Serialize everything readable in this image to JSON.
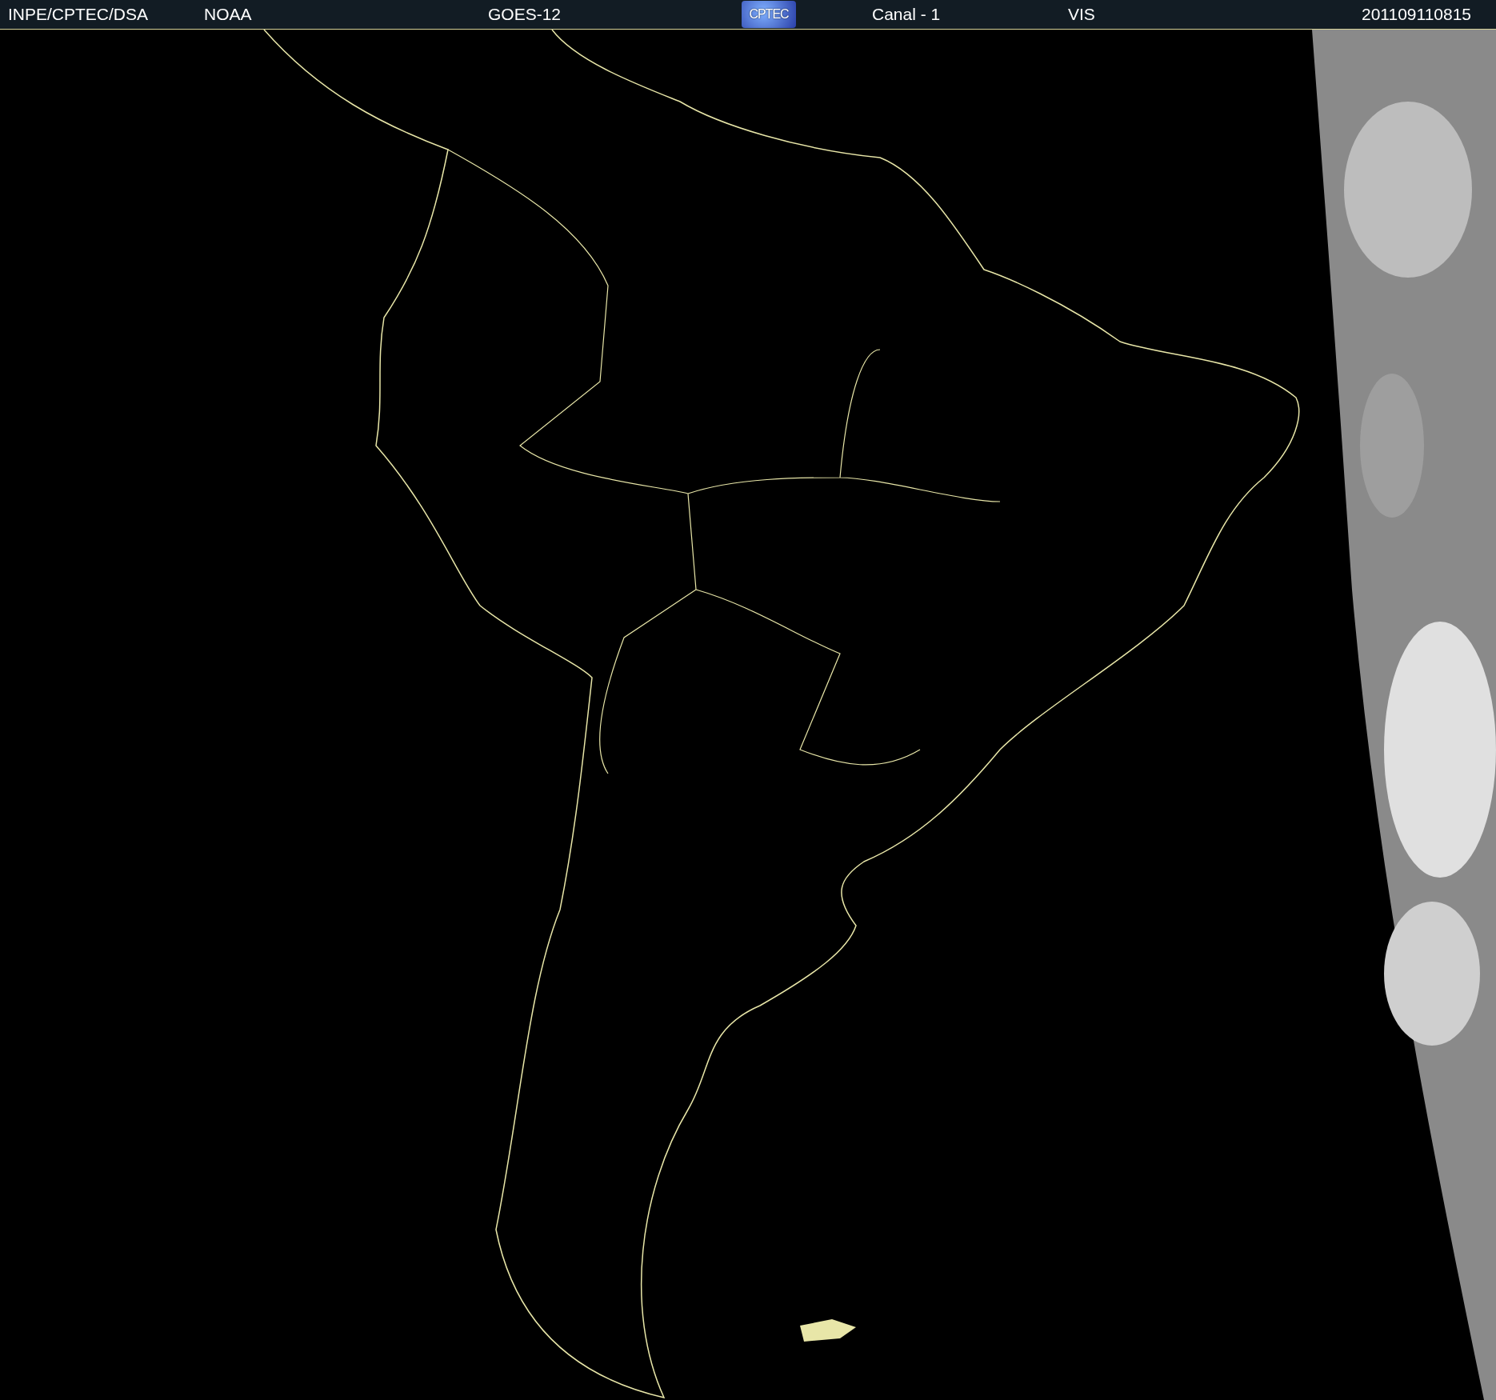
{
  "header": {
    "source": "INPE/CPTEC/DSA",
    "agency": "NOAA",
    "satellite": "GOES-12",
    "logo": "CPTEC",
    "channel": "Canal - 1",
    "band": "VIS",
    "timestamp": "201109110815"
  }
}
